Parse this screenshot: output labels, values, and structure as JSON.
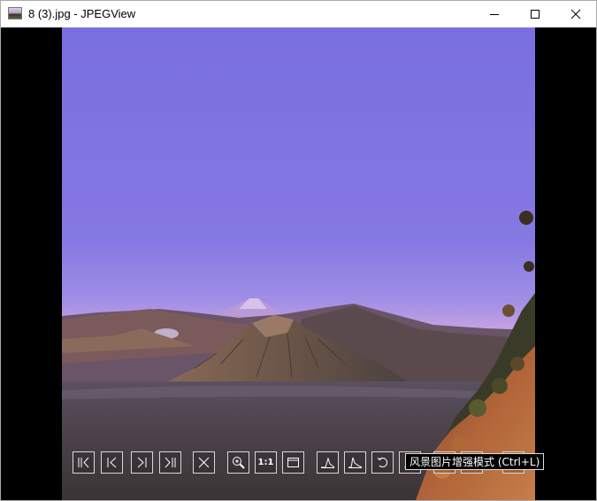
{
  "window": {
    "title": "8 (3).jpg - JPEGView",
    "controls": [
      "minimize-icon",
      "maximize-icon",
      "close-icon"
    ]
  },
  "image": {
    "subject": "mountain-landscape-photo"
  },
  "toolbar": {
    "buttons": [
      {
        "name": "first-image-button",
        "icon": "skip-first-icon"
      },
      {
        "name": "previous-image-button",
        "icon": "previous-icon"
      },
      {
        "name": "next-image-button",
        "icon": "next-icon"
      },
      {
        "name": "last-image-button",
        "icon": "skip-last-icon"
      },
      {
        "name": "delete-button",
        "icon": "close-x-icon"
      },
      {
        "name": "zoom-button",
        "icon": "zoom-in-icon"
      },
      {
        "name": "actual-size-button",
        "label": "1:1"
      },
      {
        "name": "fit-window-button",
        "icon": "window-icon"
      },
      {
        "name": "histogram-button",
        "icon": "histogram-icon"
      },
      {
        "name": "histogram-alt-button",
        "icon": "histogram-icon"
      },
      {
        "name": "rotate-button",
        "icon": "rotate-icon"
      },
      {
        "name": "perspective-button",
        "icon": "trapezoid-icon"
      },
      {
        "name": "keep-params-button",
        "icon": "pin-icon"
      },
      {
        "name": "landscape-enhance-button",
        "icon": "landscape-icon"
      },
      {
        "name": "info-button",
        "label": "i"
      }
    ]
  },
  "tooltip": {
    "text": "风景图片增强模式 (Ctrl+L)"
  }
}
